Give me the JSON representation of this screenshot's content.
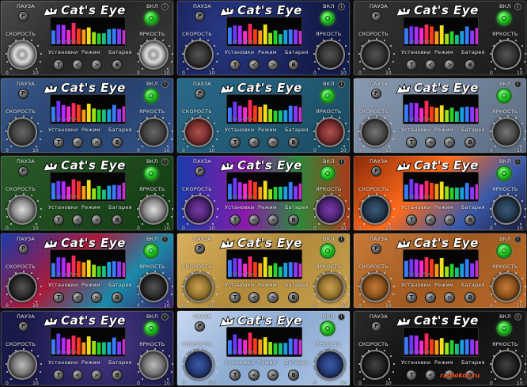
{
  "labels": {
    "title": "Cat's Eye",
    "pause": "ПАУЗА",
    "on": "ВКЛ",
    "speed": "СКОРОСТЬ",
    "brightness": "ЯРКОСТЬ",
    "settings": "Установки",
    "mode": "Режим",
    "battery": "Батарея",
    "zero": "0",
    "ten": "10",
    "pause_key": "P",
    "btn_t": "T",
    "btn_left": "<",
    "btn_right": ">",
    "btn_b": "B",
    "info_icon": "i",
    "screen_caption": "Cat's Eye"
  },
  "watermark": "radiokot.ru",
  "bar_values": [
    0.62,
    0.78,
    0.7,
    0.58,
    0.8,
    0.66,
    0.55,
    0.72,
    0.47,
    0.5,
    0.44,
    0.53,
    0.64,
    0.56,
    0.6
  ],
  "bar_colors": [
    "#3a7cff",
    "#6a38ff",
    "#b02cff",
    "#ff2ad0",
    "#ff2a5a",
    "#ff3a1a",
    "#ff9a1a",
    "#f0e01a",
    "#9ae01a",
    "#2ad02a",
    "#1ac080",
    "#1aa0e0",
    "#3a7cff",
    "#8a3aff",
    "#d02ad0"
  ],
  "skins": [
    {
      "name": "brushed-steel",
      "bg": "linear-gradient(135deg,#4a4a4a,#262626 50%,#3c3c3c)",
      "knob": "radial-gradient(circle at 50% 50%,#eee 0,#999 20%,#ddd 40%,#777 70%,#aaa)"
    },
    {
      "name": "navy-dots",
      "bg": "radial-gradient(circle at 30% 40%,#2a3a8a,#141c4a 70%)",
      "knob": "radial-gradient(circle,#555,#222 70%)"
    },
    {
      "name": "dark-grid",
      "bg": "linear-gradient(135deg,#333,#1a1a1a)",
      "knob": "radial-gradient(circle,#555,#222 70%)"
    },
    {
      "name": "denim",
      "bg": "linear-gradient(135deg,#3a5a8a,#25406a 50%,#34558a)",
      "knob": "radial-gradient(circle,#666,#333 70%)"
    },
    {
      "name": "teal-metal",
      "bg": "linear-gradient(135deg,#2a6a8a,#1a4a60)",
      "knob": "radial-gradient(circle,#b05050,#602020 70%)"
    },
    {
      "name": "pattern-grey",
      "bg": "linear-gradient(135deg,#8a9ab0,#5a6a80)",
      "knob": "radial-gradient(circle,#777,#333 70%)"
    },
    {
      "name": "circuit-green",
      "bg": "linear-gradient(135deg,#2a5a2a,#123a12)",
      "knob": "radial-gradient(circle,#ddd,#777 60%,#333)"
    },
    {
      "name": "rainbow",
      "bg": "linear-gradient(90deg,#1a3aaa,#8a1aaa 40%,#2a8a3a 70%,#aa3a1a)",
      "knob": "radial-gradient(circle,#7a3aaa,#3a1a5a 70%)"
    },
    {
      "name": "fire",
      "bg": "linear-gradient(135deg,#8a2a0a,#ff6a1a 40%,#3a5aaa 70%,#1a1a3a)",
      "knob": "radial-gradient(circle,#3a5a7a,#1a2a3a 70%)"
    },
    {
      "name": "neon-graffiti",
      "bg": "linear-gradient(135deg,#1a3aaa,#aa1a3a 40%,#1a8aaa 70%,#3a1a6a)",
      "knob": "radial-gradient(circle,#555,#1a1a1a 70%)"
    },
    {
      "name": "gold",
      "bg": "linear-gradient(135deg,#d8b060,#b08a3a 50%,#c8a050)",
      "knob": "radial-gradient(circle,#c8a050,#806020 70%)"
    },
    {
      "name": "copper",
      "bg": "linear-gradient(135deg,#c87a3a,#a05a20 50%,#b86a2a)",
      "knob": "radial-gradient(circle,#c87a3a,#704010 70%)"
    },
    {
      "name": "galaxy",
      "bg": "radial-gradient(circle at 60% 40%,#4a3a8a,#1a1a4a 70%)",
      "knob": "radial-gradient(circle,#bbb,#555 70%)"
    },
    {
      "name": "frost",
      "bg": "linear-gradient(135deg,#c8d8f0,#8aa8d0 50%,#b0c8e8)",
      "knob": "radial-gradient(circle,#3a5aaa,#1a2a5a 70%)"
    },
    {
      "name": "carbon",
      "bg": "linear-gradient(135deg,#2a2a2a,#0f0f0f 50%,#222)",
      "knob": "radial-gradient(circle,#444,#111 70%)"
    }
  ]
}
